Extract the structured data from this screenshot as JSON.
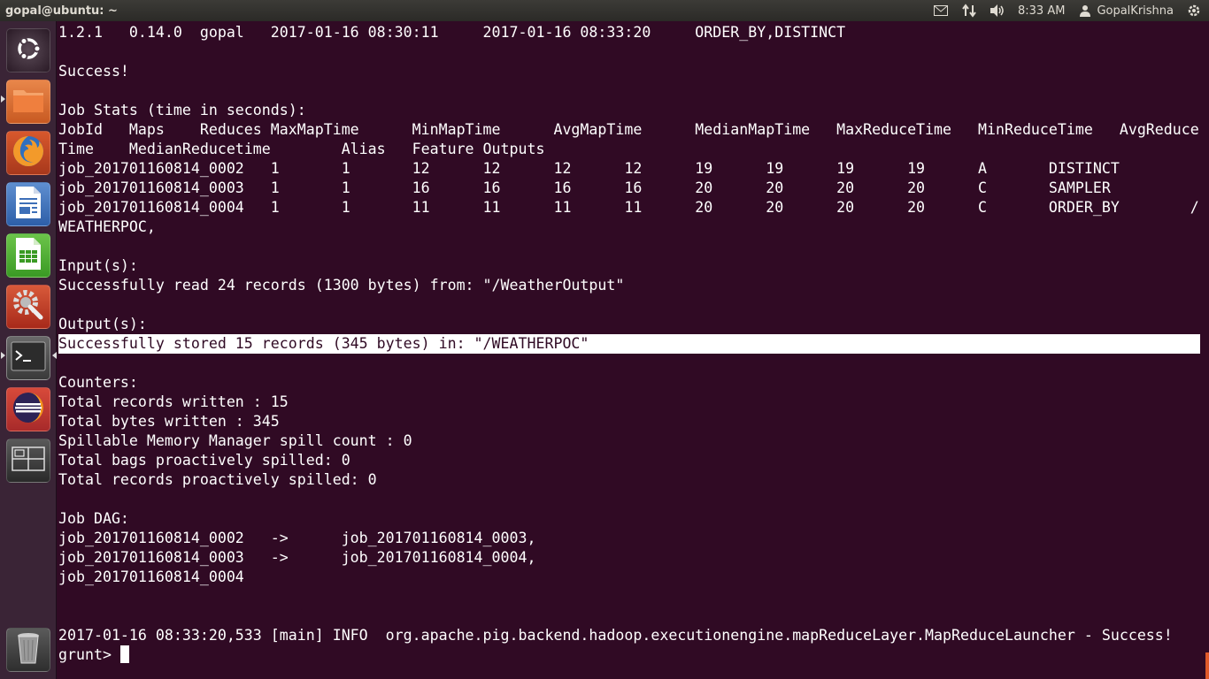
{
  "panel": {
    "title": "gopal@ubuntu: ~",
    "time": "8:33 AM",
    "user": "GopalKrishna"
  },
  "launcher": {
    "items": [
      {
        "name": "Dash Home",
        "icon": "ubuntu-logo-icon"
      },
      {
        "name": "Files",
        "icon": "folder-icon"
      },
      {
        "name": "Firefox Web Browser",
        "icon": "firefox-icon"
      },
      {
        "name": "LibreOffice Writer",
        "icon": "writer-icon"
      },
      {
        "name": "LibreOffice Calc",
        "icon": "calc-icon"
      },
      {
        "name": "System Settings",
        "icon": "settings-icon"
      },
      {
        "name": "Terminal",
        "icon": "terminal-icon"
      },
      {
        "name": "Eclipse",
        "icon": "eclipse-icon"
      },
      {
        "name": "Workspace Switcher",
        "icon": "workspace-icon"
      },
      {
        "name": "Trash",
        "icon": "trash-icon"
      }
    ]
  },
  "terminal": {
    "lines": [
      "1.2.1   0.14.0  gopal   2017-01-16 08:30:11     2017-01-16 08:33:20     ORDER_BY,DISTINCT",
      "",
      "Success!",
      "",
      "Job Stats (time in seconds):",
      "JobId   Maps    Reduces MaxMapTime      MinMapTime      AvgMapTime      MedianMapTime   MaxReduceTime   MinReduceTime   AvgReduce",
      "Time    MedianReducetime        Alias   Feature Outputs",
      "job_201701160814_0002   1       1       12      12      12      12      19      19      19      19      A       DISTINCT",
      "job_201701160814_0003   1       1       16      16      16      16      20      20      20      20      C       SAMPLER",
      "job_201701160814_0004   1       1       11      11      11      11      20      20      20      20      C       ORDER_BY        /",
      "WEATHERPOC,",
      "",
      "Input(s):",
      "Successfully read 24 records (1300 bytes) from: \"/WeatherOutput\"",
      "",
      "Output(s):",
      "Successfully stored 15 records (345 bytes) in: \"/WEATHERPOC\"",
      "",
      "Counters:",
      "Total records written : 15",
      "Total bytes written : 345",
      "Spillable Memory Manager spill count : 0",
      "Total bags proactively spilled: 0",
      "Total records proactively spilled: 0",
      "",
      "Job DAG:",
      "job_201701160814_0002   ->      job_201701160814_0003,",
      "job_201701160814_0003   ->      job_201701160814_0004,",
      "job_201701160814_0004",
      "",
      "",
      "2017-01-16 08:33:20,533 [main] INFO  org.apache.pig.backend.hadoop.executionengine.mapReduceLayer.MapReduceLauncher - Success!"
    ],
    "prompt": "grunt> "
  },
  "colors": {
    "terminal_bg": "#300a24",
    "terminal_fg": "#ffffff",
    "panel_bg": "#3c3b37",
    "launcher_bg": "#3a2436"
  }
}
